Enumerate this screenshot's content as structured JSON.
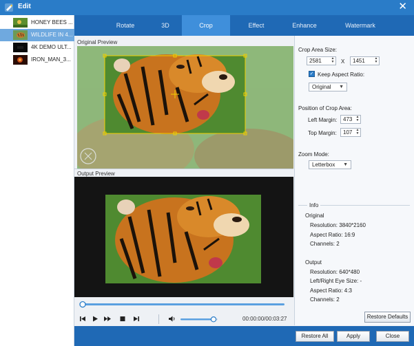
{
  "window": {
    "title": "Edit"
  },
  "files": [
    {
      "name": "HONEY BEES ...",
      "selected": false
    },
    {
      "name": "WILDLIFE IN 4...",
      "selected": true
    },
    {
      "name": "4K DEMO ULT...",
      "selected": false
    },
    {
      "name": "IRON_MAN_3...",
      "selected": false
    }
  ],
  "tabs": [
    {
      "label": "Rotate",
      "active": false
    },
    {
      "label": "3D",
      "active": false
    },
    {
      "label": "Crop",
      "active": true
    },
    {
      "label": "Effect",
      "active": false
    },
    {
      "label": "Enhance",
      "active": false
    },
    {
      "label": "Watermark",
      "active": false
    }
  ],
  "preview": {
    "original_label": "Original Preview",
    "output_label": "Output Preview"
  },
  "player": {
    "timecode": "00:00:00/00:03:27",
    "progress": 0.0,
    "volume": 0.75
  },
  "crop": {
    "area_size_label": "Crop Area Size:",
    "width": "2581",
    "x_sep": "X",
    "height": "1451",
    "keep_aspect_label": "Keep Aspect Ratio:",
    "keep_aspect_checked": true,
    "aspect_option": "Original",
    "position_label": "Position of Crop Area:",
    "left_margin_label": "Left Margin:",
    "left_margin": "473",
    "top_margin_label": "Top Margin:",
    "top_margin": "107",
    "zoom_mode_label": "Zoom Mode:",
    "zoom_mode": "Letterbox"
  },
  "info": {
    "heading": "Info",
    "original_heading": "Original",
    "original_resolution": "Resolution: 3840*2160",
    "original_aspect": "Aspect Ratio: 16:9",
    "original_channels": "Channels: 2",
    "output_heading": "Output",
    "output_resolution": "Resolution: 640*480",
    "output_lr_eye": "Left/Right Eye Size: -",
    "output_aspect": "Aspect Ratio: 4:3",
    "output_channels": "Channels: 2"
  },
  "buttons": {
    "restore_defaults": "Restore Defaults",
    "restore_all": "Restore All",
    "apply": "Apply",
    "close": "Close"
  },
  "colors": {
    "title_bar": "#2a7cc8",
    "tab_bar": "#1f69b5",
    "tab_active": "#3f8fdb",
    "crop_frame": "#f0d000"
  },
  "icons": {
    "close": "close-icon",
    "app": "app-icon",
    "play": "play-icon",
    "volume": "volume-icon"
  }
}
